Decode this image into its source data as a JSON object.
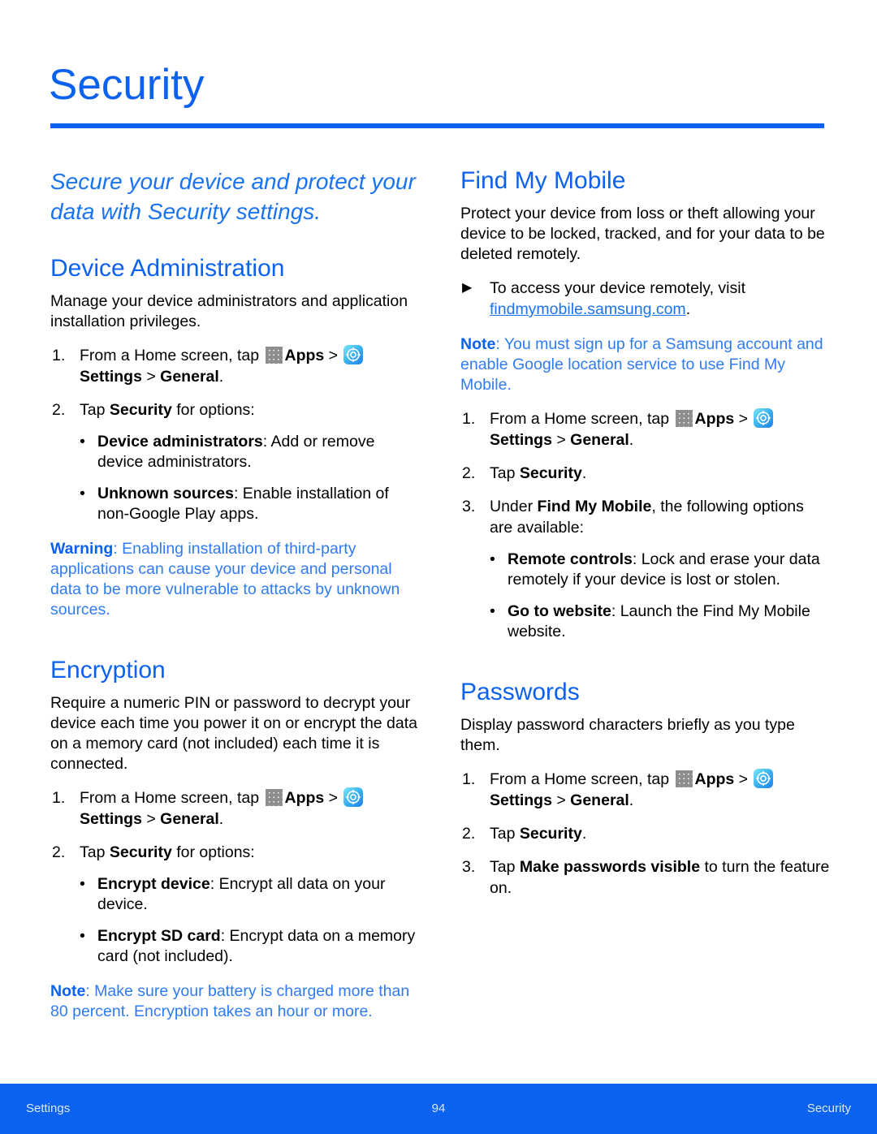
{
  "page": {
    "title": "Security",
    "accent_color": "#0b61f0",
    "note_color": "#2f7bf4"
  },
  "left_column": {
    "lede": "Secure your device and protect your data with Security settings.",
    "device_administration": {
      "heading": "Device Administration",
      "intro": "Manage your device administrators and application installation privileges.",
      "steps": [
        {
          "num": "1.",
          "pre": "From a Home screen, tap ",
          "apps_label": "Apps",
          "sep": " > ",
          "settings_label": "Settings",
          "tail_sep": " > ",
          "tail_bold": "General",
          "tail_end": "."
        },
        {
          "num": "2.",
          "pre": "Tap ",
          "bold": "Security",
          "post": " for options:"
        }
      ],
      "options": [
        {
          "term": "Device administrators",
          "desc": ": Add or remove device administrators."
        },
        {
          "term": "Unknown sources",
          "desc": ": Enable installation of non-Google Play apps."
        }
      ],
      "warning": {
        "label": "Warning",
        "text": ": Enabling installation of third-party applications can cause your device and personal data to be more vulnerable to attacks by unknown sources."
      }
    },
    "encryption": {
      "heading": "Encryption",
      "intro": "Require a numeric PIN or password to decrypt your device each time you power it on or encrypt the data on a memory card (not included) each time it is connected.",
      "steps": [
        {
          "num": "1.",
          "pre": "From a Home screen, tap ",
          "apps_label": "Apps",
          "sep": " > ",
          "settings_label": "Settings",
          "tail_sep": " > ",
          "tail_bold": "General",
          "tail_end": "."
        },
        {
          "num": "2.",
          "pre": "Tap ",
          "bold": "Security",
          "post": " for options:"
        }
      ],
      "options": [
        {
          "term": "Encrypt device",
          "desc": ": Encrypt all data on your device."
        },
        {
          "term": "Encrypt SD card",
          "desc": ": Encrypt data on a memory card (not included)."
        }
      ],
      "note": {
        "label": "Note",
        "text": ": Make sure your battery is charged more than 80 percent. Encryption takes an hour or more."
      }
    }
  },
  "right_column": {
    "find_my_mobile": {
      "heading": "Find My Mobile",
      "intro": "Protect your device from loss or theft allowing your device to be locked, tracked, and for your data to be deleted remotely.",
      "arrow_item": {
        "pre": "To access your device remotely, visit ",
        "link": "findmymobile.samsung.com",
        "post": "."
      },
      "note": {
        "label": "Note",
        "text": ": You must sign up for a Samsung account and enable Google location service to use Find My Mobile."
      },
      "steps": [
        {
          "num": "1.",
          "pre": "From a Home screen, tap ",
          "apps_label": "Apps",
          "sep": " > ",
          "settings_label": "Settings",
          "tail_sep": " > ",
          "tail_bold": "General",
          "tail_end": "."
        },
        {
          "num": "2.",
          "pre": "Tap ",
          "bold": "Security",
          "post": "."
        },
        {
          "num": "3.",
          "pre": "Under ",
          "bold": "Find My Mobile",
          "post": ", the following options are available:"
        }
      ],
      "options": [
        {
          "term": "Remote controls",
          "desc": ": Lock and erase your data remotely if your device is lost or stolen."
        },
        {
          "term": "Go to website",
          "desc": ": Launch the Find My Mobile website."
        }
      ]
    },
    "passwords": {
      "heading": "Passwords",
      "intro": "Display password characters briefly as you type them.",
      "steps": [
        {
          "num": "1.",
          "pre": "From a Home screen, tap ",
          "apps_label": "Apps",
          "sep": " > ",
          "settings_label": "Settings",
          "tail_sep": " > ",
          "tail_bold": "General",
          "tail_end": "."
        },
        {
          "num": "2.",
          "pre": "Tap ",
          "bold": "Security",
          "post": "."
        },
        {
          "num": "3.",
          "pre": "Tap ",
          "bold": "Make passwords visible",
          "post": " to turn the feature on."
        }
      ]
    }
  },
  "footer": {
    "left": "Settings",
    "page_number": "94",
    "right": "Security"
  },
  "icons": {
    "apps": "apps-grid-icon",
    "settings": "settings-gear-icon",
    "arrow_bullet": "▶",
    "dot_bullet": "•"
  }
}
